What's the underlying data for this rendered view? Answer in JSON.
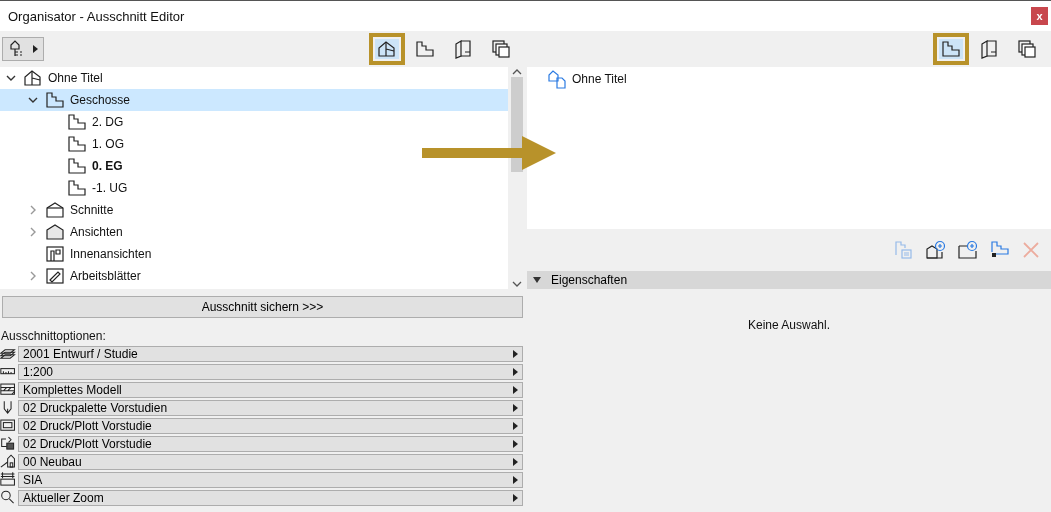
{
  "window": {
    "title": "Organisator - Ausschnitt Editor",
    "close": "x"
  },
  "left_panel": {
    "toolbar": {
      "tabs": [
        {
          "kind": "project",
          "selected": true
        },
        {
          "kind": "storey",
          "selected": false
        },
        {
          "kind": "layout",
          "selected": false
        },
        {
          "kind": "publisher",
          "selected": false
        }
      ]
    },
    "tree": [
      {
        "label": "Ohne Titel",
        "kind": "project",
        "expanded": true,
        "selected": false,
        "children": [
          {
            "label": "Geschosse",
            "kind": "storey",
            "expanded": true,
            "selected": true,
            "children": [
              {
                "label": "2. DG",
                "kind": "storey",
                "selected": false,
                "bold": false
              },
              {
                "label": "1. OG",
                "kind": "storey",
                "selected": false,
                "bold": false
              },
              {
                "label": "0. EG",
                "kind": "storey",
                "selected": false,
                "bold": true
              },
              {
                "label": "-1. UG",
                "kind": "storey",
                "selected": false,
                "bold": false
              }
            ]
          },
          {
            "label": "Schnitte",
            "kind": "section",
            "expanded": false,
            "selected": false
          },
          {
            "label": "Ansichten",
            "kind": "elevation",
            "expanded": false,
            "selected": false
          },
          {
            "label": "Innenansichten",
            "kind": "interior",
            "selected": false
          },
          {
            "label": "Arbeitsblätter",
            "kind": "worksheet",
            "expanded": false,
            "selected": false
          }
        ]
      }
    ],
    "save_button": "Ausschnitt sichern >>>",
    "options_label": "Ausschnittoptionen:",
    "options": [
      {
        "kind": "layers",
        "value": "2001 Entwurf / Studie"
      },
      {
        "kind": "scale",
        "value": "1:200"
      },
      {
        "kind": "structure",
        "value": "Komplettes Modell"
      },
      {
        "kind": "pen",
        "value": "02 Druckpalette Vorstudien"
      },
      {
        "kind": "model",
        "value": "02 Druck/Plott Vorstudie"
      },
      {
        "kind": "print",
        "value": "02 Druck/Plott Vorstudie"
      },
      {
        "kind": "renovation",
        "value": "00 Neubau"
      },
      {
        "kind": "dimension",
        "value": "SIA"
      },
      {
        "kind": "zoom",
        "value": "Aktueller Zoom"
      }
    ]
  },
  "right_panel": {
    "toolbar": {
      "tabs": [
        {
          "kind": "storey",
          "selected": true
        },
        {
          "kind": "layout",
          "selected": false
        },
        {
          "kind": "publisher",
          "selected": false
        }
      ]
    },
    "tree": [
      {
        "label": "Ohne Titel",
        "kind": "view-project"
      }
    ],
    "actions": [
      {
        "kind": "settings",
        "disabled": true
      },
      {
        "kind": "clone",
        "disabled": false
      },
      {
        "kind": "new-folder",
        "disabled": false
      },
      {
        "kind": "save-view",
        "disabled": false
      },
      {
        "kind": "delete",
        "disabled": true
      }
    ],
    "properties": {
      "title": "Eigenschaften",
      "expanded": true,
      "message": "Keine Auswahl."
    }
  }
}
